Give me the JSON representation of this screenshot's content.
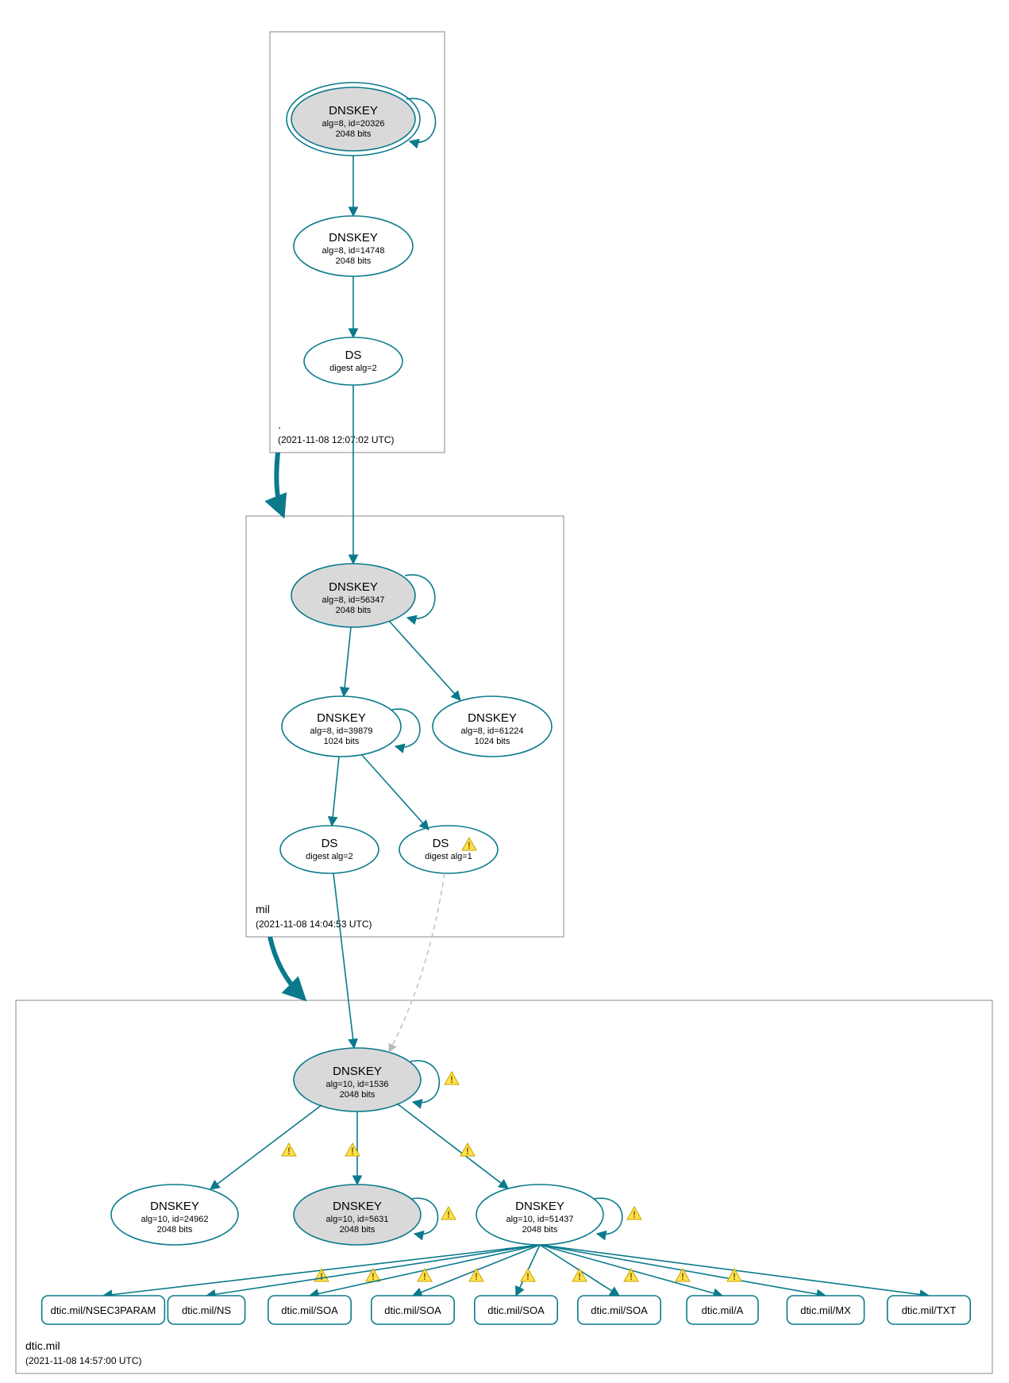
{
  "colors": {
    "stroke": "#0a7a8c",
    "grey_fill": "#d9d9d9",
    "warn_fill": "#ffe24d"
  },
  "zones": {
    "root": {
      "name": ".",
      "timestamp": "(2021-11-08 12:07:02 UTC)"
    },
    "mil": {
      "name": "mil",
      "timestamp": "(2021-11-08 14:04:53 UTC)"
    },
    "dtic": {
      "name": "dtic.mil",
      "timestamp": "(2021-11-08 14:57:00 UTC)"
    }
  },
  "nodes": {
    "root_ksk": {
      "title": "DNSKEY",
      "line2": "alg=8, id=20326",
      "line3": "2048 bits"
    },
    "root_zsk": {
      "title": "DNSKEY",
      "line2": "alg=8, id=14748",
      "line3": "2048 bits"
    },
    "root_ds": {
      "title": "DS",
      "line2": "digest alg=2",
      "line3": ""
    },
    "mil_ksk": {
      "title": "DNSKEY",
      "line2": "alg=8, id=56347",
      "line3": "2048 bits"
    },
    "mil_zsk1": {
      "title": "DNSKEY",
      "line2": "alg=8, id=39879",
      "line3": "1024 bits"
    },
    "mil_zsk2": {
      "title": "DNSKEY",
      "line2": "alg=8, id=61224",
      "line3": "1024 bits"
    },
    "mil_ds1": {
      "title": "DS",
      "line2": "digest alg=2",
      "line3": ""
    },
    "mil_ds2": {
      "title": "DS",
      "line2": "digest alg=1",
      "line3": ""
    },
    "dtic_ksk": {
      "title": "DNSKEY",
      "line2": "alg=10, id=1536",
      "line3": "2048 bits"
    },
    "dtic_k1": {
      "title": "DNSKEY",
      "line2": "alg=10, id=24962",
      "line3": "2048 bits"
    },
    "dtic_k2": {
      "title": "DNSKEY",
      "line2": "alg=10, id=5631",
      "line3": "2048 bits"
    },
    "dtic_k3": {
      "title": "DNSKEY",
      "line2": "alg=10, id=51437",
      "line3": "2048 bits"
    }
  },
  "leaves": [
    "dtic.mil/NSEC3PARAM",
    "dtic.mil/NS",
    "dtic.mil/SOA",
    "dtic.mil/SOA",
    "dtic.mil/SOA",
    "dtic.mil/SOA",
    "dtic.mil/A",
    "dtic.mil/MX",
    "dtic.mil/TXT"
  ],
  "warn_label": "!"
}
